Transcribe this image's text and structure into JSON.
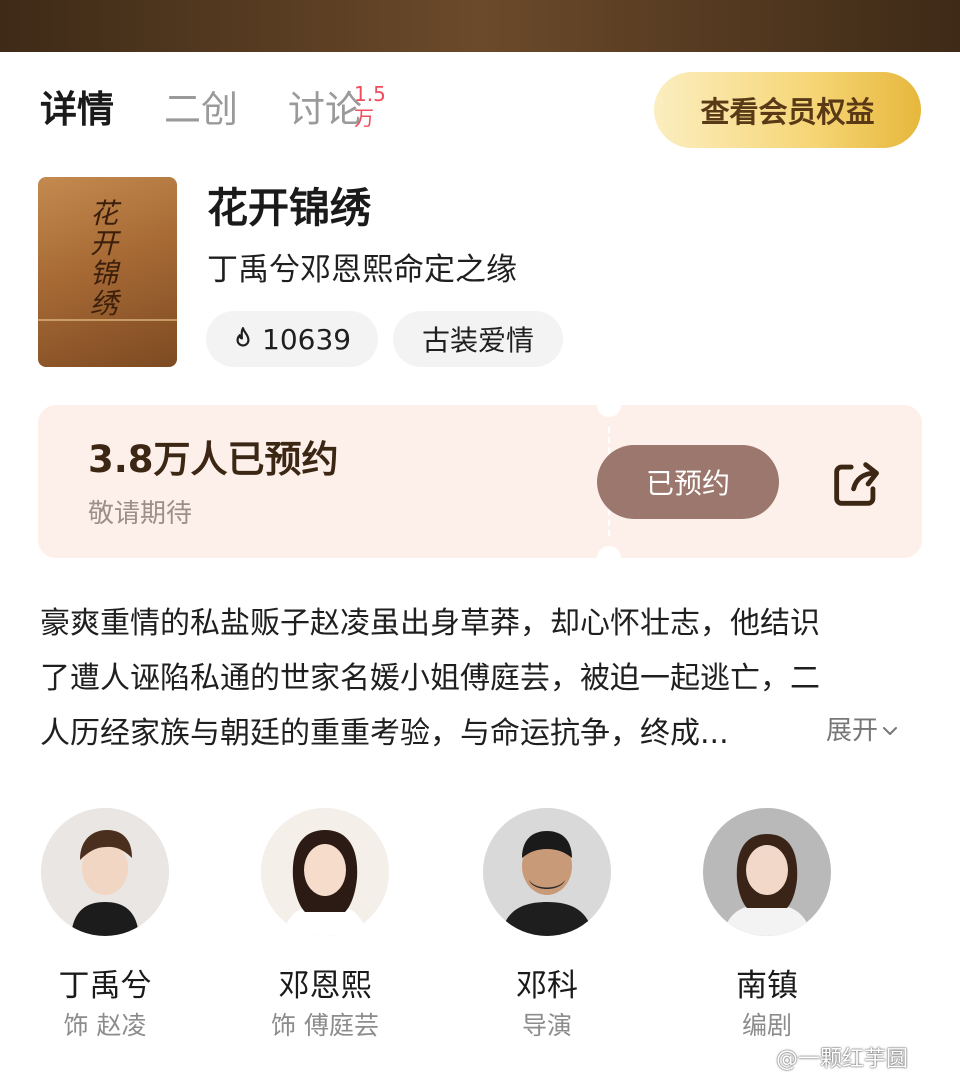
{
  "tabs": [
    {
      "label": "详情",
      "active": true
    },
    {
      "label": "二创",
      "active": false
    },
    {
      "label": "讨论",
      "active": false,
      "badge": "1.5万"
    }
  ],
  "vip_button": "查看会员权益",
  "show": {
    "poster_text": "花开锦绣",
    "title": "花开锦绣",
    "subtitle": "丁禹兮邓恩熙命定之缘",
    "heat": "10639",
    "heat_icon": "flame-icon",
    "genre": "古装爱情"
  },
  "booking": {
    "count_text": "3.8万人已预约",
    "note": "敬请期待",
    "button": "已预约",
    "share_icon": "share-icon"
  },
  "synopsis": {
    "lines": [
      "豪爽重情的私盐贩子赵凌虽出身草莽，却心怀壮志，他结识",
      "了遭人诬陷私通的世家名媛小姐傅庭芸，被迫一起逃亡，二",
      "人历经家族与朝廷的重重考验，与命运抗争，终成..."
    ],
    "expand": "展开"
  },
  "cast": [
    {
      "name": "丁禹兮",
      "role": "饰 赵凌"
    },
    {
      "name": "邓恩熙",
      "role": "饰 傅庭芸"
    },
    {
      "name": "邓科",
      "role": "导演"
    },
    {
      "name": "南镇",
      "role": "编剧"
    }
  ],
  "watermark": "@一颗红芋圆",
  "colors": {
    "accent": "#9b776d",
    "vip_gold": "#f6d575",
    "badge_red": "#ef4d5b"
  }
}
